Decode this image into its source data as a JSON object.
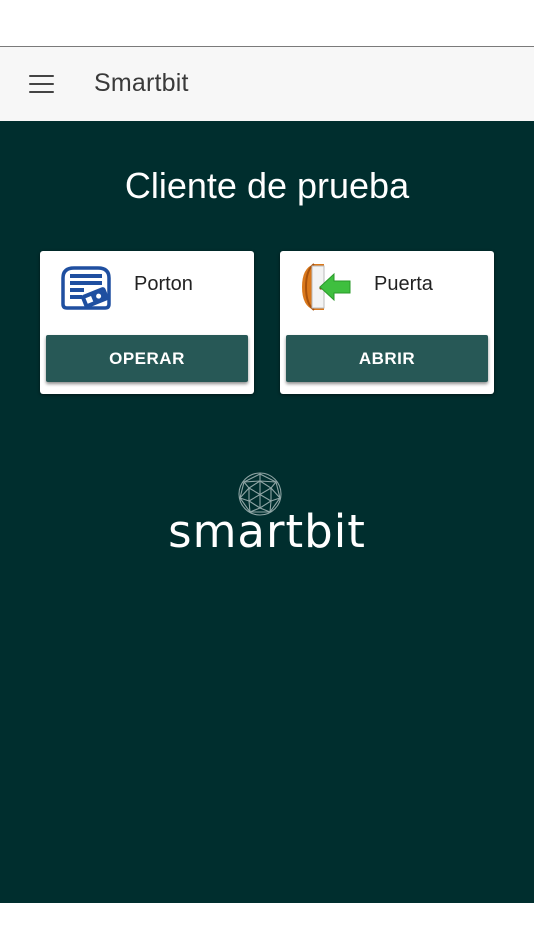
{
  "app_bar": {
    "title": "Smartbit",
    "menu_icon": "hamburger-menu-icon"
  },
  "main": {
    "client_name": "Cliente de prueba",
    "cards": [
      {
        "label": "Porton",
        "icon": "garage-gate-remote-icon",
        "button_label": "OPERAR"
      },
      {
        "label": "Puerta",
        "icon": "door-enter-arrow-icon",
        "button_label": "ABRIR"
      }
    ],
    "brand": {
      "text": "smartbit",
      "logo_icon": "geodesic-sphere-logo"
    }
  },
  "colors": {
    "background": "#002e2e",
    "app_bar": "#f7f7f7",
    "button": "#275856",
    "gate_icon": "#1f4fa0",
    "door_frame": "#d9781c",
    "arrow": "#3fbf3f"
  }
}
